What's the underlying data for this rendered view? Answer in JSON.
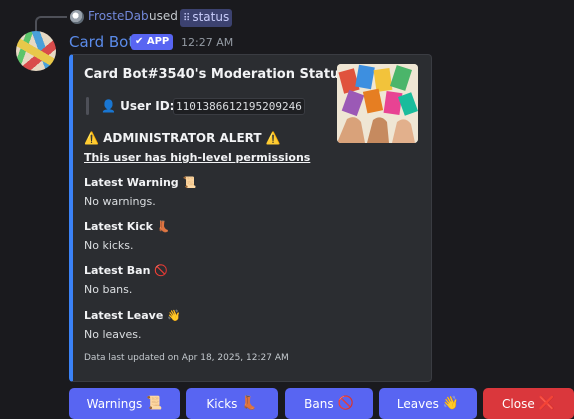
{
  "reply": {
    "user": "FrosteDab",
    "used": "used",
    "command_glyph": "⠿",
    "command": "status"
  },
  "message": {
    "author": "Card Bot",
    "badge": "✔ APP",
    "time": "12:27 AM"
  },
  "embed": {
    "accent_color": "#3b82f6",
    "title": "Card Bot#3540's Moderation Status",
    "user_id_label": "👤 User ID:",
    "user_id": "1101386612195209246",
    "alert_title": "⚠️ ADMINISTRATOR ALERT ⚠️",
    "alert_subtitle": "This user has high-level permissions",
    "fields": [
      {
        "name": "Latest Warning 📜",
        "value": "No warnings."
      },
      {
        "name": "Latest Kick 👢",
        "value": "No kicks."
      },
      {
        "name": "Latest Ban 🚫",
        "value": "No bans."
      },
      {
        "name": "Latest Leave 👋",
        "value": "No leaves."
      }
    ],
    "footer": "Data last updated on Apr 18, 2025, 12:27 AM"
  },
  "buttons": [
    {
      "label": "Warnings",
      "emoji": "📜",
      "style": "primary"
    },
    {
      "label": "Kicks",
      "emoji": "👢",
      "style": "primary"
    },
    {
      "label": "Bans",
      "emoji": "🚫",
      "style": "primary"
    },
    {
      "label": "Leaves",
      "emoji": "👋",
      "style": "primary"
    },
    {
      "label": "Close",
      "emoji": "❌",
      "style": "danger"
    }
  ]
}
